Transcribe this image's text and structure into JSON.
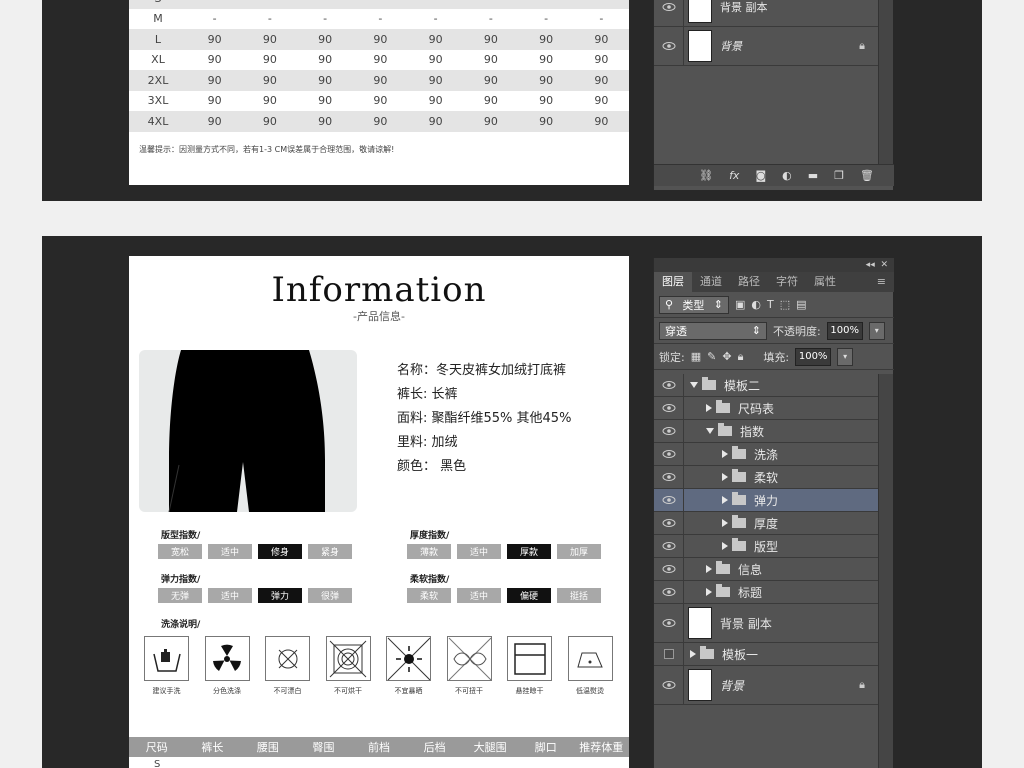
{
  "size_table": {
    "rows": [
      {
        "size": "S",
        "values": [
          "",
          "",
          "",
          "",
          "",
          "",
          "",
          ""
        ]
      },
      {
        "size": "M",
        "values": [
          "-",
          "-",
          "-",
          "-",
          "-",
          "-",
          "-",
          "-"
        ]
      },
      {
        "size": "L",
        "values": [
          "90",
          "90",
          "90",
          "90",
          "90",
          "90",
          "90",
          "90"
        ]
      },
      {
        "size": "XL",
        "values": [
          "90",
          "90",
          "90",
          "90",
          "90",
          "90",
          "90",
          "90"
        ]
      },
      {
        "size": "2XL",
        "values": [
          "90",
          "90",
          "90",
          "90",
          "90",
          "90",
          "90",
          "90"
        ]
      },
      {
        "size": "3XL",
        "values": [
          "90",
          "90",
          "90",
          "90",
          "90",
          "90",
          "90",
          "90"
        ]
      },
      {
        "size": "4XL",
        "values": [
          "90",
          "90",
          "90",
          "90",
          "90",
          "90",
          "90",
          "90"
        ]
      }
    ],
    "tip": "温馨提示：因测量方式不同，若有1-3 CM误差属于合理范围，敬请谅解!"
  },
  "top_layers": {
    "items": [
      {
        "name": "背景 副本"
      },
      {
        "name": "背景"
      }
    ]
  },
  "info": {
    "title": "Information",
    "subtitle": "-产品信息-",
    "specs": [
      "名称：冬天皮裤女加绒打底裤",
      "裤长: 长裤",
      "面料: 聚酯纤维55%  其他45%",
      "里料: 加绒",
      "颜色：  黑色"
    ],
    "indexes": [
      {
        "label": "版型指数/",
        "options": [
          "宽松",
          "适中",
          "修身",
          "紧身"
        ],
        "selected": "修身"
      },
      {
        "label": "厚度指数/",
        "options": [
          "薄款",
          "适中",
          "厚款",
          "加厚"
        ],
        "selected": "厚款"
      },
      {
        "label": "弹力指数/",
        "options": [
          "无弹",
          "适中",
          "弹力",
          "很弹"
        ],
        "selected": "弹力"
      },
      {
        "label": "柔软指数/",
        "options": [
          "柔软",
          "适中",
          "偏硬",
          "挺括"
        ],
        "selected": "偏硬"
      }
    ],
    "care_label": "洗涤说明/",
    "care_items": [
      "建议手洗",
      "分色洗涤",
      "不可漂白",
      "不可烘干",
      "不宜暴晒",
      "不可扭干",
      "悬挂晾干",
      "低温熨烫"
    ],
    "size_header": [
      "尺码",
      "裤长",
      "腰围",
      "臀围",
      "前档",
      "后档",
      "大腿围",
      "脚口",
      "推荐体重"
    ],
    "size_first": "S"
  },
  "panel": {
    "tabs": [
      "图层",
      "通道",
      "路径",
      "字符",
      "属性"
    ],
    "filter_label": "类型",
    "blend_mode": "穿透",
    "opacity_label": "不透明度:",
    "opacity_value": "100%",
    "lock_label": "锁定:",
    "fill_label": "填充:",
    "fill_value": "100%",
    "layers": [
      {
        "name": "模板二",
        "indent": 0,
        "kind": "folder",
        "open": true
      },
      {
        "name": "尺码表",
        "indent": 1,
        "kind": "folder",
        "open": false
      },
      {
        "name": "指数",
        "indent": 1,
        "kind": "folder",
        "open": true
      },
      {
        "name": "洗涤",
        "indent": 2,
        "kind": "folder",
        "open": false
      },
      {
        "name": "柔软",
        "indent": 2,
        "kind": "folder",
        "open": false
      },
      {
        "name": "弹力",
        "indent": 2,
        "kind": "folder",
        "open": false,
        "selected": true
      },
      {
        "name": "厚度",
        "indent": 2,
        "kind": "folder",
        "open": false
      },
      {
        "name": "版型",
        "indent": 2,
        "kind": "folder",
        "open": false
      },
      {
        "name": "信息",
        "indent": 1,
        "kind": "folder",
        "open": false
      },
      {
        "name": "标题",
        "indent": 1,
        "kind": "folder",
        "open": false
      },
      {
        "name": "背景 副本",
        "indent": 0,
        "kind": "image"
      },
      {
        "name": "模板一",
        "indent": 0,
        "kind": "folder",
        "open": false,
        "hidden": true
      },
      {
        "name": "背景",
        "indent": 0,
        "kind": "image",
        "locked": true
      }
    ]
  },
  "colors": {
    "panel": "#535353",
    "selected_layer": "#5f6a80",
    "artboard": "#282828"
  }
}
